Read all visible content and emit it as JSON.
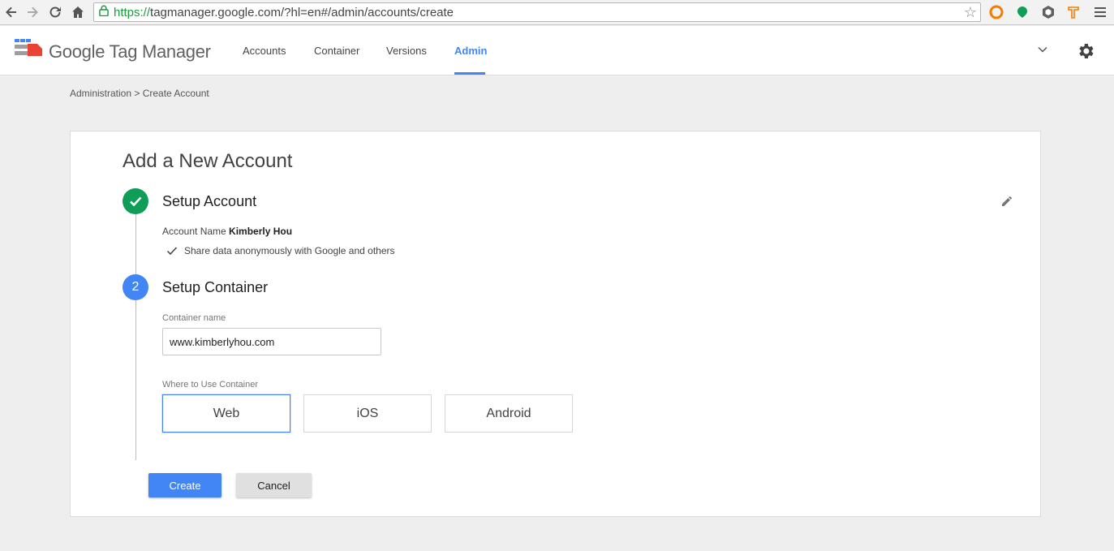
{
  "browser": {
    "url_scheme": "https://",
    "url_rest": "tagmanager.google.com/?hl=en#/admin/accounts/create"
  },
  "header": {
    "brand": "Google Tag Manager",
    "nav": [
      "Accounts",
      "Container",
      "Versions",
      "Admin"
    ],
    "active_nav": "Admin"
  },
  "breadcrumb": "Administration > Create Account",
  "card": {
    "title": "Add a New Account",
    "step1": {
      "title": "Setup Account",
      "account_label": "Account Name",
      "account_value": "Kimberly Hou",
      "share_text": "Share data anonymously with Google and others"
    },
    "step2": {
      "number": "2",
      "title": "Setup Container",
      "container_label": "Container name",
      "container_value": "www.kimberlyhou.com",
      "where_label": "Where to Use Container",
      "platforms": [
        "Web",
        "iOS",
        "Android"
      ],
      "selected_platform": "Web"
    },
    "create_label": "Create",
    "cancel_label": "Cancel"
  },
  "colors": {
    "accent": "#4285f4",
    "success": "#0f9d58"
  }
}
